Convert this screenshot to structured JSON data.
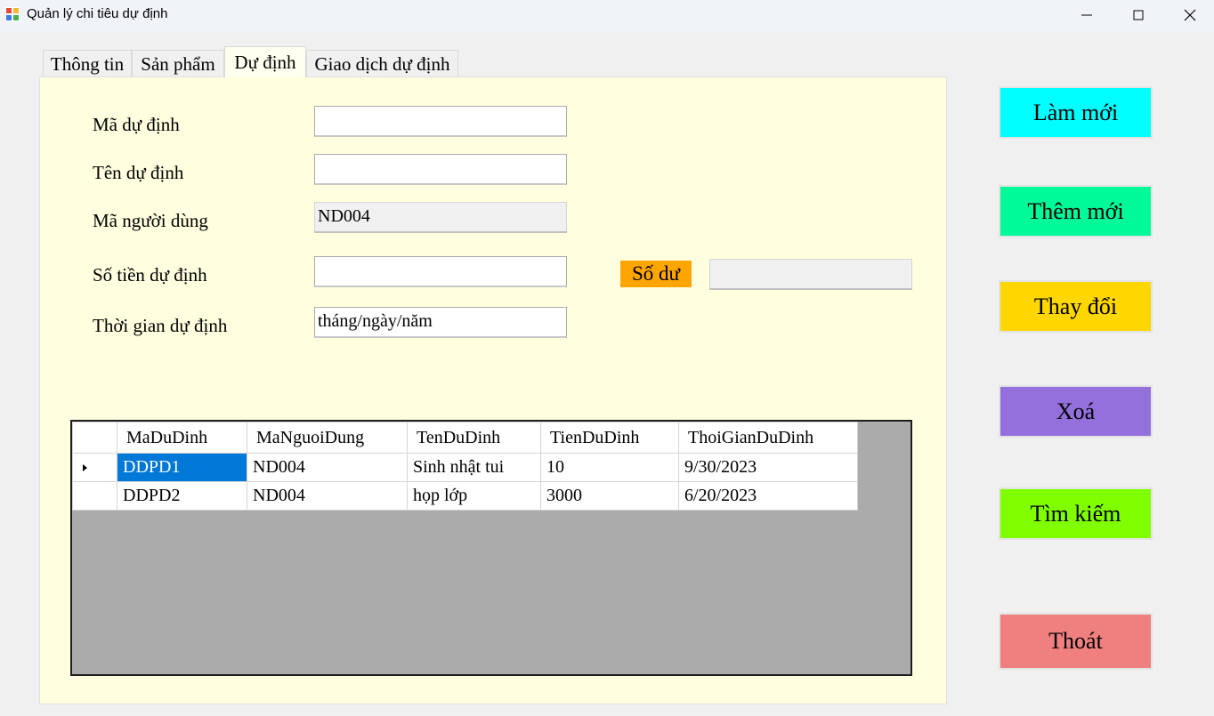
{
  "window": {
    "title": "Quản lý chi tiêu dự định"
  },
  "tabs": [
    "Thông tin",
    "Sản phẩm",
    "Dự định",
    "Giao dịch dự định"
  ],
  "form": {
    "ma_du_dinh": {
      "label": "Mã dự định",
      "value": ""
    },
    "ten_du_dinh": {
      "label": "Tên dự định",
      "value": ""
    },
    "ma_nguoi_dung": {
      "label": "Mã người dùng",
      "value": "ND004"
    },
    "so_tien_du_dinh": {
      "label": "Số tiền dự định",
      "value": ""
    },
    "thoi_gian_du_dinh": {
      "label": "Thời gian dự định",
      "value": "tháng/ngày/năm"
    },
    "so_du": {
      "label": "Số dư",
      "value": ""
    }
  },
  "grid": {
    "columns": [
      "MaDuDinh",
      "MaNguoiDung",
      "TenDuDinh",
      "TienDuDinh",
      "ThoiGianDuDinh"
    ],
    "rows": [
      [
        "DDPD1",
        "ND004",
        "Sinh nhật tui",
        "10",
        "9/30/2023"
      ],
      [
        "DDPD2",
        "ND004",
        "họp lớp",
        "3000",
        "6/20/2023"
      ]
    ],
    "selected_row": 0
  },
  "buttons": {
    "lam_moi": "Làm mới",
    "them_moi": "Thêm mới",
    "thay_doi": "Thay đổi",
    "xoa": "Xoá",
    "tim_kiem": "Tìm kiếm",
    "thoat": "Thoát"
  },
  "colors": {
    "panel_bg": "#ffffe0",
    "lam_moi": "#00ffff",
    "them_moi": "#00fa9a",
    "thay_doi": "#ffd700",
    "xoa": "#9370db",
    "tim_kiem": "#7fff00",
    "thoat": "#f08080",
    "so_du_label": "#ffa500",
    "selection": "#0078d7"
  }
}
